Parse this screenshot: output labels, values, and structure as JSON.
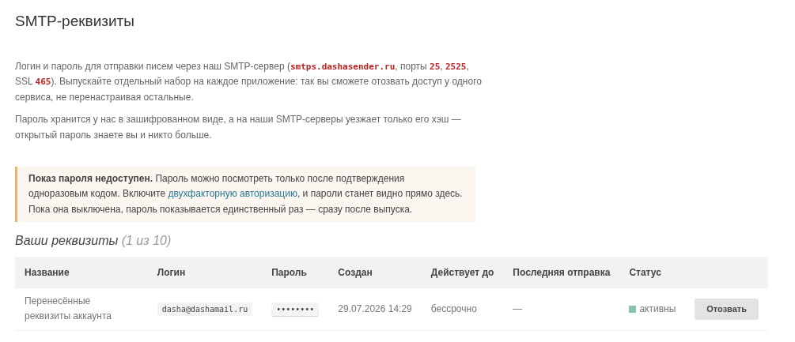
{
  "title": "SMTP-реквизиты",
  "intro": [
    [
      {
        "kind": "text",
        "text": "Логин и пароль для отправки писем через наш SMTP-сервер ("
      },
      {
        "kind": "code",
        "text": "smtps.dashasender.ru"
      },
      {
        "kind": "text",
        "text": ", порты "
      },
      {
        "kind": "code",
        "text": "25"
      },
      {
        "kind": "text",
        "text": ", "
      },
      {
        "kind": "code",
        "text": "2525"
      },
      {
        "kind": "text",
        "text": ", SSL "
      },
      {
        "kind": "code",
        "text": "465"
      },
      {
        "kind": "text",
        "text": "). Выпускайте отдельный набор на каждое приложение: так вы сможете отозвать доступ у одного сервиса, не перенастраивая остальные."
      }
    ],
    [
      {
        "kind": "text",
        "text": "Пароль хранится у нас в зашифрованном виде, а на наши SMTP-серверы уезжает только его хэш — открытый пароль знаете вы и никто больше."
      }
    ]
  ],
  "notice": [
    {
      "kind": "text",
      "text": "**Показ пароля недоступен.** Пароль можно посмотреть только после подтверждения одноразовым кодом. Включите "
    },
    {
      "kind": "link",
      "text": "двухфакторную авторизацию"
    },
    {
      "kind": "text",
      "text": ", и пароли станет видно прямо здесь. Пока она выключена, пароль показывается единственный раз — сразу после выпуска."
    }
  ],
  "section": {
    "title": "Ваши реквизиты",
    "count": "(1 из 10)"
  },
  "table": {
    "columns": [
      "Название",
      "Логин",
      "Пароль",
      "Создан",
      "Действует до",
      "Последняя отправка",
      "Статус"
    ],
    "rows": [
      {
        "name": "Перенесённые реквизиты аккаунта",
        "login": "dasha@dashamail.ru",
        "password": "••••••••",
        "created": "29.07.2026 14:29",
        "valid_until": "бессрочно",
        "last_sent": "—",
        "status": {
          "label": "активны",
          "color": "#86c4b0"
        },
        "action": "Отозвать"
      }
    ]
  }
}
